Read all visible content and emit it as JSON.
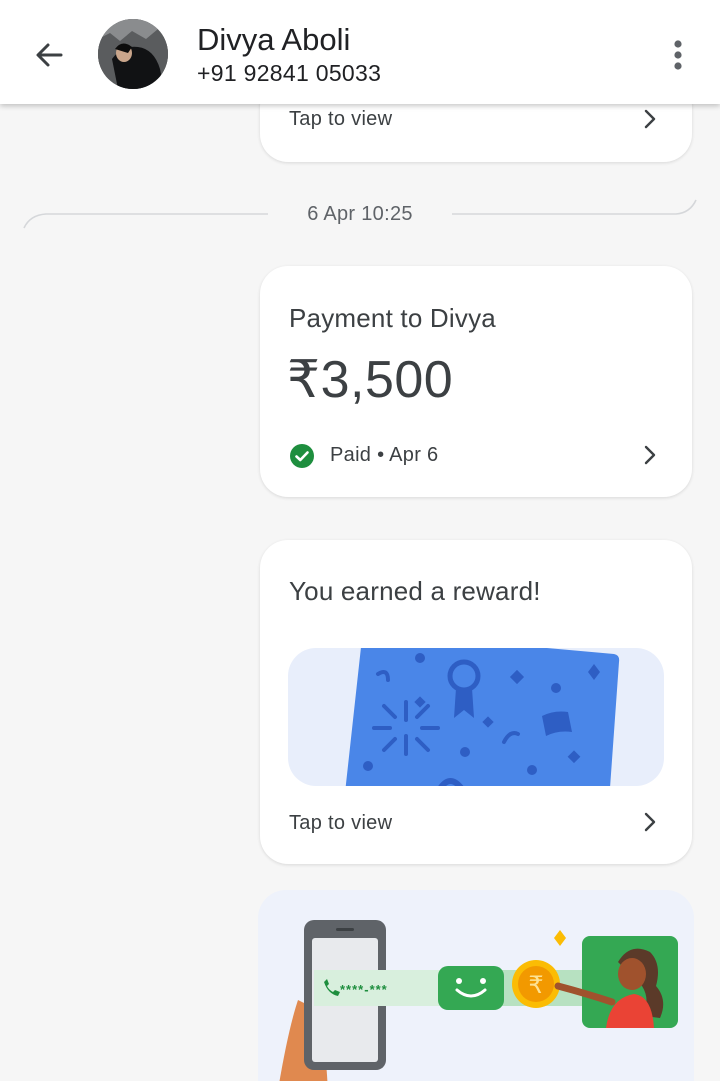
{
  "header": {
    "name": "Divya Aboli",
    "phone": "+91 92841 05033",
    "back_icon": "arrow-left-icon",
    "menu_icon": "more-vertical-icon"
  },
  "top_card": {
    "link_label": "Tap to view"
  },
  "date_separator": "6 Apr 10:25",
  "payment": {
    "title": "Payment to Divya",
    "amount": "₹3,500",
    "status": "Paid • Apr 6",
    "status_color": "#1e8e3e"
  },
  "reward": {
    "title": "You earned a reward!",
    "link_label": "Tap to view",
    "card_color": "#4a86e8",
    "panel_color": "#e8eefb"
  },
  "promo": {
    "masked_number": "****-***",
    "currency_symbol": "₹"
  }
}
